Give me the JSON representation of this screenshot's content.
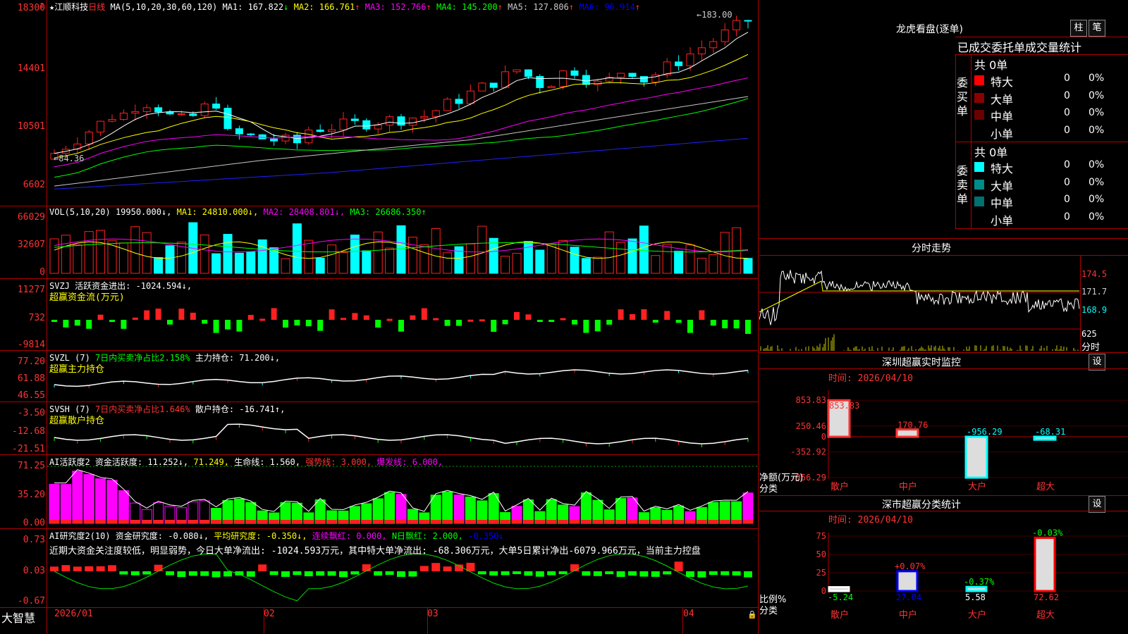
{
  "stock": {
    "star": "★",
    "name": "江顺科技",
    "period": "日线",
    "ma_params": "MA(5,10,20,30,60,120)",
    "ma": [
      {
        "label": "MA1: 167.822",
        "arrow": "↓",
        "color": "#ffffff"
      },
      {
        "label": "MA2: 166.761",
        "arrow": "↑",
        "color": "#ffff00"
      },
      {
        "label": "MA3: 152.766",
        "arrow": "↑",
        "color": "#ff00ff"
      },
      {
        "label": "MA4: 145.200",
        "arrow": "↑",
        "color": "#00ff00"
      },
      {
        "label": "MA5: 127.806",
        "arrow": "↑",
        "color": "#c8c8c8"
      },
      {
        "label": "MA6: 96.914",
        "arrow": "↑",
        "color": "#0000ff"
      }
    ],
    "high_mark": "183.00",
    "low_mark": "84.36"
  },
  "price_axis": [
    "18300",
    "14401",
    "10501",
    "6602"
  ],
  "vol": {
    "header": "VOL(5,10,20)",
    "value": "19950.000↓,",
    "ma": [
      {
        "label": "MA1: 24810.000↓,",
        "color": "#ffff00"
      },
      {
        "label": "MA2: 28408.801↓,",
        "color": "#ff00ff"
      },
      {
        "label": "MA3: 26686.350↑",
        "color": "#00ff00"
      }
    ],
    "axis": [
      "66029",
      "32607",
      "0"
    ]
  },
  "svzj": {
    "header": "SVZJ  活跃资金进出: -1024.594↓,",
    "sub": "超赢资金流(万元)",
    "axis": [
      "11277",
      "732",
      "-9814"
    ]
  },
  "svzl": {
    "header_name": "SVZL (7)",
    "header_mid": "7日内买卖净占比2.158%",
    "header_end": "主力持仓: 71.200↓,",
    "sub": "超赢主力持仓",
    "axis": [
      "77.20",
      "61.88",
      "46.55"
    ]
  },
  "svsh": {
    "header_name": "SVSH (7)",
    "header_mid": "7日内买卖净占比1.646%",
    "header_end": "散户持仓: -16.741↑,",
    "sub": "超赢散户持仓",
    "axis": [
      "-3.50",
      "-12.68",
      "-21.51"
    ]
  },
  "ai1": {
    "header_a": "AI活跃度2 资金活跃度: 11.252↓,",
    "header_b": "71.249,",
    "header_c": "生命线: 1.560,",
    "header_d": "强势线: 3.000,",
    "header_e": "爆发线: 6.000,",
    "axis": [
      "71.25",
      "35.20",
      "0.00"
    ]
  },
  "ai2": {
    "header_a": "AI研究度2(10) 资金研究度: -0.080↓,",
    "header_b": "平均研究度: -0.350↓,",
    "header_c": "连续飘红: 0.000,",
    "header_d": "N日飘红: 2.000,",
    "header_e": "-0.350↓",
    "text": "近期大资金关注度较低，明显弱势，今日大单净流出: -1024.593万元，其中特大单净流出: -68.306万元，大单5日累计净出-6079.966万元，当前主力控盘",
    "axis": [
      "0.73",
      "0.03",
      "-0.67"
    ]
  },
  "bottom": {
    "brand": "大智慧",
    "dates": [
      "2026/01",
      "02",
      "03",
      "04"
    ]
  },
  "lhb": {
    "title": "龙虎看盘(逐单)",
    "btn1": "柱",
    "btn2": "笔",
    "subtitle": "已成交委托单成交量统计",
    "buy_label": "委买单",
    "sell_label": "委卖单",
    "buy_total": "共 0单",
    "sell_total": "共 0单",
    "buy_rows": [
      {
        "name": "特大",
        "val": "0",
        "pct": "0%",
        "color": "#ff0000"
      },
      {
        "name": "大单",
        "val": "0",
        "pct": "0%",
        "color": "#8b0000"
      },
      {
        "name": "中单",
        "val": "0",
        "pct": "0%",
        "color": "#6b0000"
      },
      {
        "name": "小单",
        "val": "0",
        "pct": "0%",
        "color": "#000000"
      }
    ],
    "sell_rows": [
      {
        "name": "特大",
        "val": "0",
        "pct": "0%",
        "color": "#00ffff"
      },
      {
        "name": "大单",
        "val": "0",
        "pct": "0%",
        "color": "#008b8b"
      },
      {
        "name": "中单",
        "val": "0",
        "pct": "0%",
        "color": "#007070"
      },
      {
        "name": "小单",
        "val": "0",
        "pct": "0%",
        "color": "#000000"
      }
    ]
  },
  "fenshi": {
    "title": "分时走势",
    "axis": [
      "174.5",
      "171.7",
      "168.9"
    ],
    "vol_label": "625",
    "vol_unit": "分时"
  },
  "sz_monitor": {
    "title": "深圳超赢实时监控",
    "btn": "设",
    "time": "时间: 2026/04/10",
    "axis": [
      "853.83",
      "250.46",
      "0",
      "-352.92",
      "-956.29"
    ],
    "unit1": "净额(万元)",
    "unit2": "分类",
    "categories": [
      "散户",
      "中户",
      "大户",
      "超大"
    ],
    "bar_labels": [
      "853.83",
      "170.76",
      "-956.29",
      "-68.31"
    ],
    "values": [
      853.83,
      170.76,
      -956.29,
      -68.31
    ]
  },
  "sz_stats": {
    "title": "深市超赢分类统计",
    "btn": "设",
    "time": "时间: 2026/04/10",
    "axis": [
      "75",
      "50",
      "25",
      "0"
    ],
    "unit1": "比例%",
    "unit2": "分类",
    "categories": [
      "散户",
      "中户",
      "大户",
      "超大"
    ],
    "top_labels": [
      "",
      "+0.07%",
      "-0.37%",
      "-0.03%"
    ],
    "bottom_labels": [
      "-5.24",
      "27.04",
      "5.58",
      "72.62"
    ],
    "values": [
      5.24,
      27.04,
      5.58,
      72.62
    ],
    "colors": [
      "#ffffff",
      "#0000ff",
      "#00ffff",
      "#ff0000"
    ]
  }
}
